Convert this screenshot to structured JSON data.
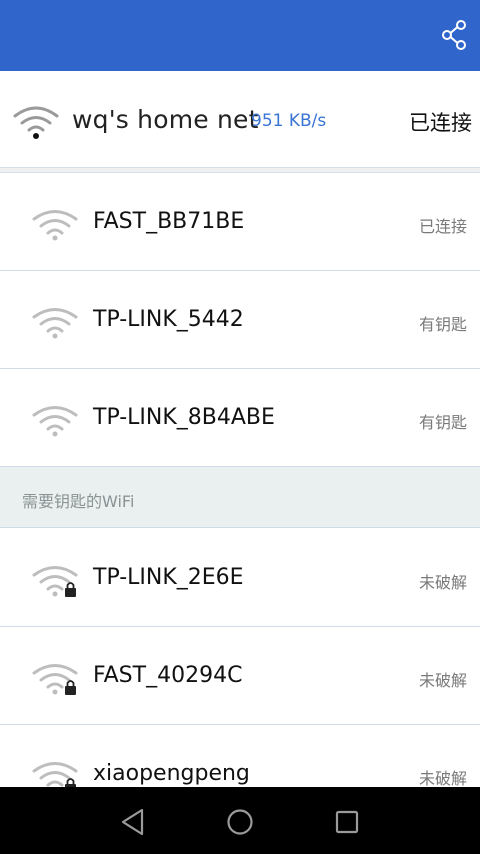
{
  "app_bar": {
    "share_icon": "share-icon"
  },
  "current": {
    "ssid": "wq's home net",
    "speed": "951 KB/s",
    "state": "已连接"
  },
  "free_networks": [
    {
      "ssid": "FAST_BB71BE",
      "status": "已连接"
    },
    {
      "ssid": "TP-LINK_5442",
      "status": "有钥匙"
    },
    {
      "ssid": "TP-LINK_8B4ABE",
      "status": "有钥匙"
    }
  ],
  "locked_section": {
    "title": "需要钥匙的WiFi",
    "networks": [
      {
        "ssid": "TP-LINK_2E6E",
        "status": "未破解"
      },
      {
        "ssid": "FAST_40294C",
        "status": "未破解"
      },
      {
        "ssid": "xiaopengpeng",
        "status": "未破解"
      }
    ]
  },
  "navbar": {
    "back": "back-icon",
    "home": "home-icon",
    "recents": "recents-icon"
  },
  "colors": {
    "app_bar": "#3066cc",
    "speed": "#3a74d4",
    "section_bg": "#e9f0ef"
  }
}
